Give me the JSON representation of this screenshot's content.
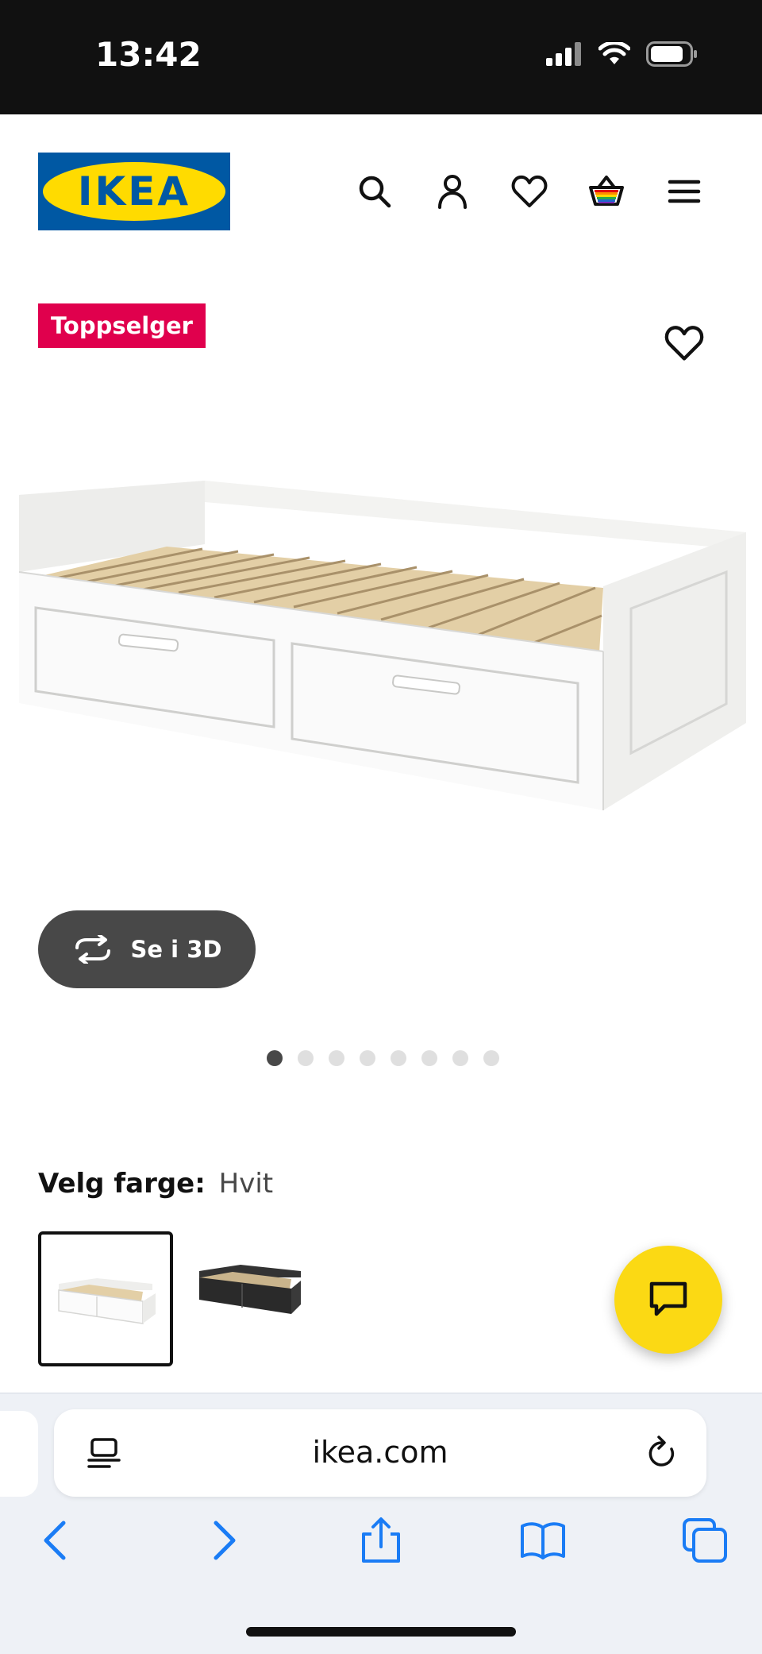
{
  "status_bar": {
    "time": "13:42"
  },
  "header": {
    "logo_text": "IKEA",
    "icons": [
      "search-icon",
      "account-icon",
      "heart-icon",
      "cart-icon",
      "menu-icon"
    ]
  },
  "product": {
    "badge": "Toppselger",
    "view_3d_label": "Se i 3D",
    "gallery_dots": 8,
    "active_dot": 0
  },
  "color_picker": {
    "label": "Velg farge:",
    "selected_value": "Hvit",
    "options": [
      "white",
      "black"
    ]
  },
  "browser": {
    "url": "ikea.com",
    "toolbar_icons": [
      "back-icon",
      "forward-icon",
      "share-icon",
      "bookmarks-icon",
      "tabs-icon"
    ]
  },
  "colors": {
    "badge_bg": "#e0004d",
    "ikea_blue": "#0058a3",
    "ikea_yellow": "#ffdb00",
    "chat_yellow": "#fbd914",
    "ios_blue": "#1a7cf5"
  }
}
